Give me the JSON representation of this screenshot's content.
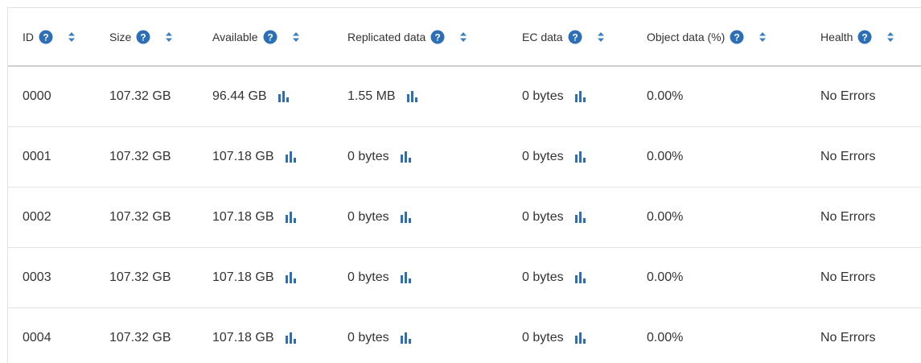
{
  "columns": [
    {
      "label": "ID"
    },
    {
      "label": "Size"
    },
    {
      "label": "Available"
    },
    {
      "label": "Replicated data"
    },
    {
      "label": "EC data"
    },
    {
      "label": "Object data (%)"
    },
    {
      "label": "Health"
    }
  ],
  "rows": [
    {
      "id": "0000",
      "size": "107.32 GB",
      "available": "96.44 GB",
      "replicated": "1.55 MB",
      "ec": "0 bytes",
      "object_pct": "0.00%",
      "health": "No Errors"
    },
    {
      "id": "0001",
      "size": "107.32 GB",
      "available": "107.18 GB",
      "replicated": "0 bytes",
      "ec": "0 bytes",
      "object_pct": "0.00%",
      "health": "No Errors"
    },
    {
      "id": "0002",
      "size": "107.32 GB",
      "available": "107.18 GB",
      "replicated": "0 bytes",
      "ec": "0 bytes",
      "object_pct": "0.00%",
      "health": "No Errors"
    },
    {
      "id": "0003",
      "size": "107.32 GB",
      "available": "107.18 GB",
      "replicated": "0 bytes",
      "ec": "0 bytes",
      "object_pct": "0.00%",
      "health": "No Errors"
    },
    {
      "id": "0004",
      "size": "107.32 GB",
      "available": "107.18 GB",
      "replicated": "0 bytes",
      "ec": "0 bytes",
      "object_pct": "0.00%",
      "health": "No Errors"
    }
  ],
  "icons": {
    "help": "help-icon",
    "sort": "sort-icon",
    "chart": "bar-chart-icon"
  },
  "colors": {
    "accent": "#2d6fb7",
    "sort": "#3b7fc4",
    "text": "#333333",
    "border": "#e3e3e3"
  }
}
